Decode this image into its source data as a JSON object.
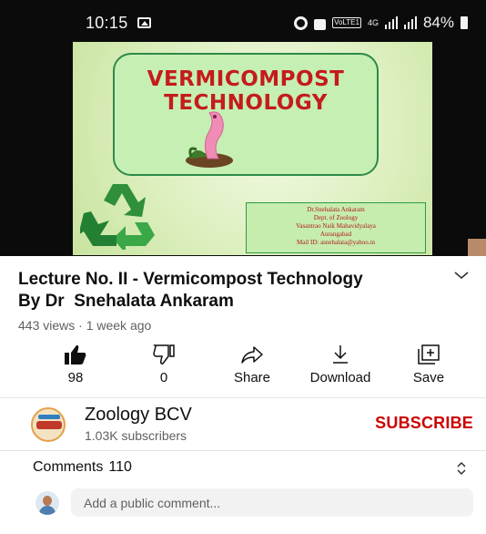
{
  "status_bar": {
    "time": "10:15",
    "volte": "VoLTE1",
    "network": "4G",
    "battery": "84%"
  },
  "slide": {
    "title_line1": "VERMICOMPOST",
    "title_line2": "TECHNOLOGY",
    "credit": [
      "Dr.Snehalata Ankaram",
      "Dept. of Zoology",
      "Vasantrao Naik Mahavidyalaya",
      "Aurangabad",
      "Mail ID: asnehalata@yahoo.in"
    ]
  },
  "video": {
    "title_line1": "Lecture No. II - Vermicompost Technology",
    "title_line2": "By Dr  Snehalata Ankaram",
    "meta": "443 views · 1 week ago"
  },
  "actions": {
    "like": "98",
    "dislike": "0",
    "share": "Share",
    "download": "Download",
    "save": "Save"
  },
  "channel": {
    "name": "Zoology BCV",
    "subscribers": "1.03K subscribers",
    "subscribe_label": "SUBSCRIBE"
  },
  "comments": {
    "label": "Comments",
    "count": "110",
    "placeholder": "Add a public comment..."
  },
  "colors": {
    "subscribe": "#cc0000",
    "slide_title": "#c41c1c",
    "slide_border": "#2e8a49"
  }
}
